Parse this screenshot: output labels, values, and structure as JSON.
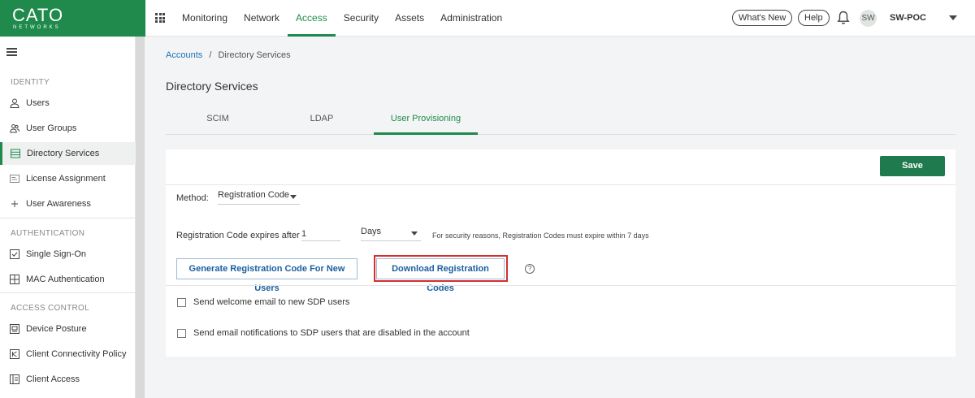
{
  "brand": {
    "name": "CATO",
    "tagline": "NETWORKS",
    "color": "#1f8a4c"
  },
  "topnav": {
    "items": [
      "Monitoring",
      "Network",
      "Access",
      "Security",
      "Assets",
      "Administration"
    ],
    "active": "Access",
    "whats_new": "What's New",
    "help": "Help",
    "avatar_initials": "SW",
    "account": "SW-POC"
  },
  "sidebar": {
    "sections": [
      {
        "title": "IDENTITY",
        "items": [
          "Users",
          "User Groups",
          "Directory Services",
          "License Assignment",
          "User Awareness"
        ]
      },
      {
        "title": "AUTHENTICATION",
        "items": [
          "Single Sign-On",
          "MAC Authentication"
        ]
      },
      {
        "title": "ACCESS CONTROL",
        "items": [
          "Device Posture",
          "Client Connectivity Policy",
          "Client Access"
        ]
      }
    ],
    "active_item": "Directory Services"
  },
  "breadcrumb": {
    "root": "Accounts",
    "separator": "/",
    "current": "Directory Services"
  },
  "page_title": "Directory Services",
  "tabs": [
    "SCIM",
    "LDAP",
    "User Provisioning"
  ],
  "active_tab": "User Provisioning",
  "form": {
    "save_label": "Save",
    "method_label": "Method:",
    "method_value": "Registration Code",
    "expires_label": "Registration Code expires after",
    "expires_value": "1",
    "expires_unit": "Days",
    "expires_hint": "For security reasons, Registration Codes must expire within 7 days",
    "generate_button": "Generate Registration Code For New Users",
    "download_button": "Download Registration Codes",
    "help_glyph": "?",
    "checkbox_welcome": "Send welcome email to new SDP users",
    "checkbox_disabled": "Send email notifications to SDP users that are disabled in the account"
  }
}
